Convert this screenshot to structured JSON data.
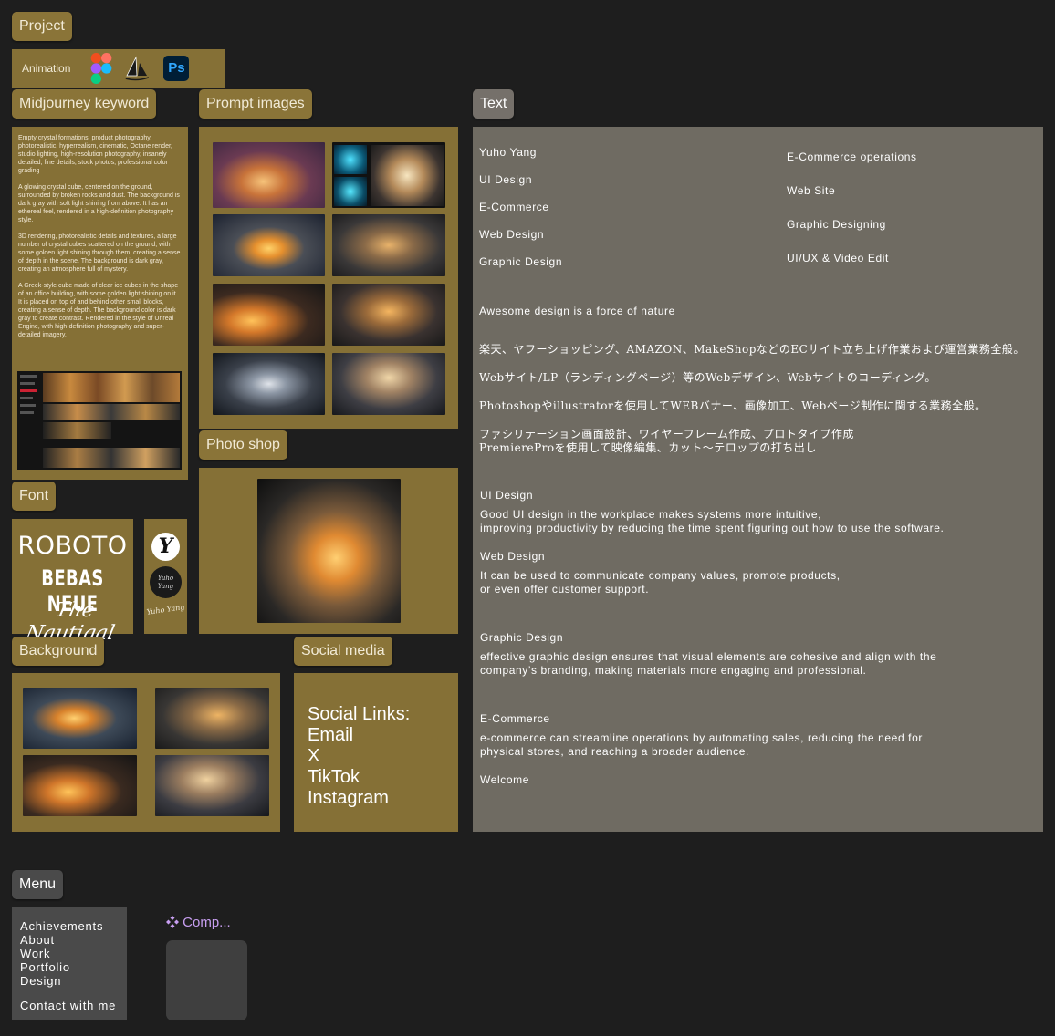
{
  "tags": {
    "project": "Project",
    "midjourney": "Midjourney keyword",
    "prompt_images": "Prompt images",
    "text": "Text",
    "photoshop": "Photo shop",
    "font": "Font",
    "background": "Background",
    "social_media": "Social media",
    "menu": "Menu"
  },
  "tools": {
    "label": "Animation",
    "icons": [
      "figma-icon",
      "midjourney-icon",
      "photoshop-icon"
    ],
    "ps_text": "Ps"
  },
  "keywords": [
    "Empty crystal formations, product photography, photorealistic, hyperrealism, cinematic, Octane render, studio lighting, high-resolution photography, insanely detailed, fine details, stock photos, professional color grading",
    "A glowing crystal cube, centered on the ground, surrounded by broken rocks and dust. The background is dark gray with soft light shining from above. It has an ethereal feel, rendered in a high-definition photography style.",
    "3D rendering, photorealistic details and textures, a large number of crystal cubes scattered on the ground, with some golden light shining through them, creating a sense of depth in the scene. The background is dark gray, creating an atmosphere full of mystery.",
    "A Greek-style cube made of clear ice cubes in the shape of an office building, with some golden light shining on it. It is placed on top of and behind other small blocks, creating a sense of depth. The background color is dark gray to create contrast. Rendered in the style of Unreal Engine, with high-definition photography and super-detailed imagery."
  ],
  "fonts": {
    "roboto": "ROBOTO",
    "bebas": "BEBAS NEUE",
    "nautigal": "The Nautigal",
    "logo_letter": "Y",
    "logo_name": "Yuho Yang",
    "signature": "Yuho Yang"
  },
  "social": {
    "title": "Social Links:",
    "links": [
      "Email",
      "X",
      "TikTok",
      "Instagram"
    ]
  },
  "text": {
    "left": [
      "Yuho Yang",
      "UI Design",
      "E-Commerce",
      "Web Design",
      "Graphic Design"
    ],
    "right": [
      "E-Commerce operations",
      "Web Site",
      "Graphic Designing",
      "UI/UX & Video Edit"
    ],
    "tagline": "Awesome design is a force of nature",
    "jp": [
      "楽天、ヤフーショッピング、AMAZON、MakeShopなどのECサイト立ち上げ作業および運営業務全般。",
      "Webサイト/LP（ランディングページ）等のWebデザイン、Webサイトのコーディング。",
      "Photoshopやillustratorを使用してWEBバナー、画像加工、Webページ制作に関する業務全般。",
      "ファシリテーション画面設計、ワイヤーフレーム作成、プロトタイプ作成",
      "PremiereProを使用して映像編集、カット〜テロップの打ち出し"
    ],
    "sections": [
      {
        "title": "UI Design",
        "lines": [
          "Good UI design in the workplace makes systems more intuitive,",
          " improving productivity by reducing the time spent figuring out how to use the software."
        ]
      },
      {
        "title": "Web Design",
        "lines": [
          "It can be used to communicate company values, promote products,",
          " or even offer customer support."
        ]
      },
      {
        "title": "Graphic Design",
        "lines": [
          "effective graphic design ensures that visual elements are cohesive and align with the",
          "company’s branding, making materials more engaging and professional."
        ]
      },
      {
        "title": "E-Commerce",
        "lines": [
          "e-commerce can streamline operations by automating sales, reducing the need for",
          " physical stores, and reaching a broader audience."
        ]
      }
    ],
    "welcome": "Welcome"
  },
  "menu": {
    "items": [
      "Achievements",
      "About",
      "Work",
      "Portfolio",
      "Design"
    ],
    "contact": "Contact with me"
  },
  "component": {
    "label": "Comp...",
    "icon": "component-icon"
  },
  "colors": {
    "background": "#1e1e1e",
    "olive_panel": "#857036",
    "olive_tag": "#8a7438",
    "text_panel": "#6f6b62",
    "component_label": "#c79ef0"
  }
}
